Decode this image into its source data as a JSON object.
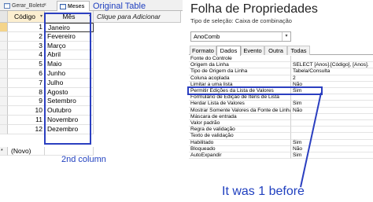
{
  "tabs": {
    "tab1_label": "Gerar_Boleto",
    "tab1_close": "×",
    "tab2_label": "Meses"
  },
  "annotations": {
    "original_table": "Original Table",
    "second_column": "2nd column",
    "it_was_1_before": "It was 1 before"
  },
  "table": {
    "headers": {
      "codigo": "Código",
      "mes": "Mês",
      "add": "Clique para Adicionar"
    },
    "sort_arrow": "▾",
    "rows": [
      {
        "codigo": "1",
        "mes": "Janeiro"
      },
      {
        "codigo": "2",
        "mes": "Fevereiro"
      },
      {
        "codigo": "3",
        "mes": "Março"
      },
      {
        "codigo": "4",
        "mes": "Abril"
      },
      {
        "codigo": "5",
        "mes": "Maio"
      },
      {
        "codigo": "6",
        "mes": "Junho"
      },
      {
        "codigo": "7",
        "mes": "Julho"
      },
      {
        "codigo": "8",
        "mes": "Agosto"
      },
      {
        "codigo": "9",
        "mes": "Setembro"
      },
      {
        "codigo": "10",
        "mes": "Outubro"
      },
      {
        "codigo": "11",
        "mes": "Novembro"
      },
      {
        "codigo": "12",
        "mes": "Dezembro"
      }
    ],
    "new_row_marker": "*",
    "new_row_label": "(Novo)"
  },
  "property_sheet": {
    "title": "Folha de Propriedades",
    "selection_type": "Tipo de seleção: Caixa de combinação",
    "selected_object": "AnoComb",
    "tabs": [
      "Formato",
      "Dados",
      "Evento",
      "Outra",
      "Todas"
    ],
    "active_tab": "Dados",
    "properties": [
      {
        "name": "Fonte do Controle",
        "value": ""
      },
      {
        "name": "Origem da Linha",
        "value": "SELECT [Anos].[Código], [Anos]."
      },
      {
        "name": "Tipo de Origem da Linha",
        "value": "Tabela/Consulta"
      },
      {
        "name": "Coluna acoplada",
        "value": "2"
      },
      {
        "name": "Limitar a uma lista",
        "value": "Não"
      },
      {
        "name": "Permitir Edições da Lista de Valores",
        "value": "Sim"
      },
      {
        "name": "Formulário de Edição de Itens de Lista",
        "value": ""
      },
      {
        "name": "Herdar Lista de Valores",
        "value": "Sim"
      },
      {
        "name": "Mostrar Somente Valores da Fonte de Linha",
        "value": "Não"
      },
      {
        "name": "Máscara de entrada",
        "value": ""
      },
      {
        "name": "Valor padrão",
        "value": ""
      },
      {
        "name": "Regra de validação",
        "value": ""
      },
      {
        "name": "Texto de validação",
        "value": ""
      },
      {
        "name": "Habilitado",
        "value": "Sim"
      },
      {
        "name": "Bloqueado",
        "value": "Não"
      },
      {
        "name": "AutoExpandir",
        "value": "Sim"
      }
    ],
    "dropdown_icon": "▾"
  },
  "colors": {
    "annotation_blue": "#2b3fc0",
    "selected_header": "#fcefd0",
    "record_selector_active": "#f4d48a"
  }
}
